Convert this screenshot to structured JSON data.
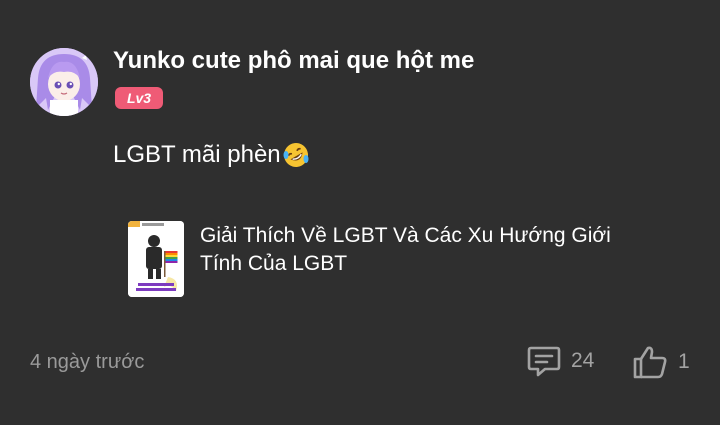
{
  "post": {
    "author_name": "Yunko cute phô mai que hột me",
    "level_badge": "Lv3",
    "text": "LGBT mãi phèn",
    "emoji_icon": "rolling-on-floor-laughing-icon",
    "link_card": {
      "title": "Giải Thích Về LGBT Và Các Xu Hướng Giới Tính Của LGBT"
    },
    "timestamp": "4 ngày trước",
    "comment_count": "24",
    "like_count": "1"
  },
  "colors": {
    "background": "#2f2f2f",
    "badge": "#ef5b76",
    "muted_text": "#9a9a9a"
  }
}
